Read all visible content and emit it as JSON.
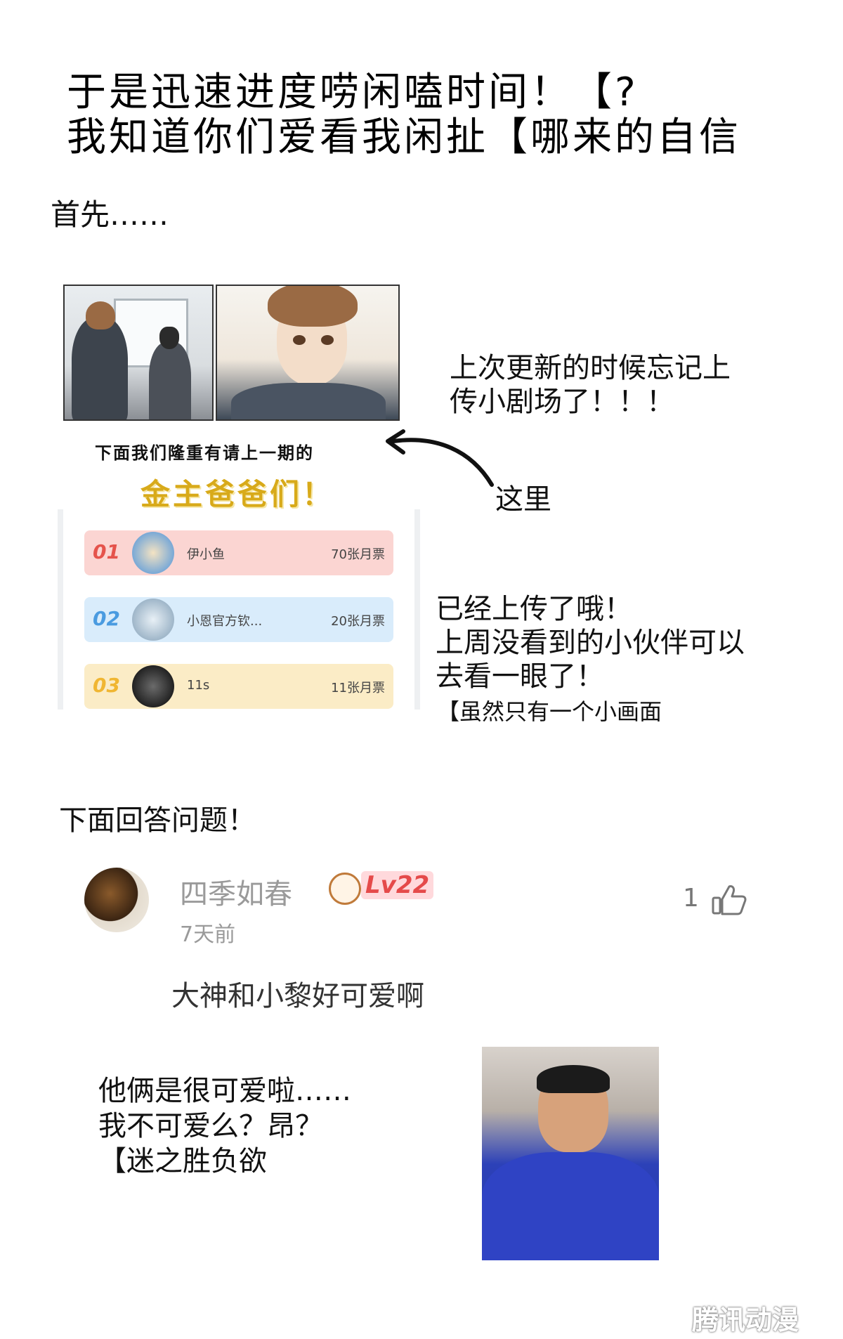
{
  "header": {
    "line1": "于是迅速进度唠闲嗑时间！【?",
    "line2": "我知道你们爱看我闲扯【哪来的自信"
  },
  "intro": "首先……",
  "section1": {
    "note_line1": "上次更新的时候忘记上",
    "note_line2": "传小剧场了！！！",
    "subtitle": "下面我们隆重有请上一期的",
    "gold_title": "金主爸爸们！",
    "pointer_label": "这里"
  },
  "leaderboard": [
    {
      "rank": "01",
      "name": "伊小鱼",
      "tickets": "70张月票",
      "bg": "#fbd5d2",
      "num_color": "#e5534b"
    },
    {
      "rank": "02",
      "name": "小恩官方钦...",
      "tickets": "20张月票",
      "bg": "#d9ecfb",
      "num_color": "#4a9be0"
    },
    {
      "rank": "03",
      "name": "11s",
      "tickets": "11张月票",
      "bg": "#fbecc6",
      "num_color": "#f0b632"
    }
  ],
  "section2": {
    "line1": "已经上传了哦！",
    "line2": "上周没看到的小伙伴可以",
    "line3": "去看一眼了！",
    "small": "【虽然只有一个小画面"
  },
  "qa": {
    "heading": "下面回答问题！",
    "user": "四季如春",
    "level": "Lv22",
    "time": "7天前",
    "likes": "1",
    "comment": "大神和小黎好可爱啊",
    "reply_line1": "他俩是很可爱啦……",
    "reply_line2": "我不可爱么？昂？",
    "reply_line3": "【迷之胜负欲"
  },
  "watermark": "腾讯动漫",
  "icons": {
    "like": "thumbs-up-icon",
    "level": "level-badge-icon",
    "arrow": "curved-arrow-icon"
  }
}
